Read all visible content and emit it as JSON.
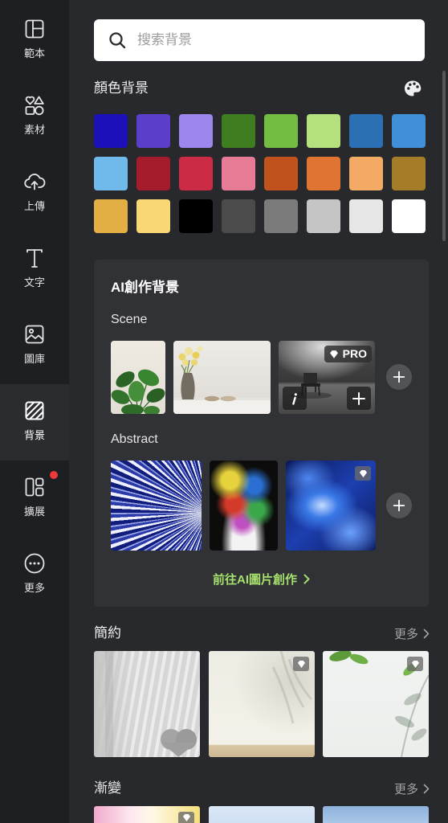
{
  "sidebar": {
    "items": [
      {
        "label": "範本",
        "icon": "template-icon"
      },
      {
        "label": "素材",
        "icon": "elements-icon"
      },
      {
        "label": "上傳",
        "icon": "upload-cloud-icon"
      },
      {
        "label": "文字",
        "icon": "text-icon"
      },
      {
        "label": "圖庫",
        "icon": "image-library-icon"
      },
      {
        "label": "背景",
        "icon": "background-icon",
        "active": true
      },
      {
        "label": "擴展",
        "icon": "extensions-icon",
        "notification_dot": true
      },
      {
        "label": "更多",
        "icon": "more-icon"
      }
    ]
  },
  "search": {
    "placeholder": "搜索背景",
    "value": "",
    "icon": "search-icon"
  },
  "color_backgrounds": {
    "title": "顏色背景",
    "icon": "palette-icon",
    "swatches": [
      "#1c10b8",
      "#5b3fcb",
      "#9d87ef",
      "#3f7e20",
      "#74bd43",
      "#b4e07e",
      "#2b6fb4",
      "#3f90d6",
      "#6fbaea",
      "#a41b2b",
      "#cc2b46",
      "#e87b96",
      "#c0531c",
      "#e07432",
      "#f3aa65",
      "#a57c27",
      "#e3ae44",
      "#f9d774",
      "#000000",
      "#4b4b4b",
      "#7b7b7b",
      "#c5c5c5",
      "#e6e6e6",
      "#ffffff"
    ]
  },
  "ai_backgrounds": {
    "title": "AI創作背景",
    "scene": {
      "label": "Scene",
      "pro_badge": "PRO"
    },
    "abstract": {
      "label": "Abstract"
    },
    "cta": "前往AI圖片創作"
  },
  "categories": [
    {
      "title": "簡約",
      "more": "更多"
    },
    {
      "title": "漸變",
      "more": "更多"
    }
  ],
  "colors": {
    "sidebar_bg": "#1e1f22",
    "panel_bg": "#28292c",
    "active_item_bg": "#2b2c30",
    "card_bg": "#313236",
    "accent_green": "#a6e06d",
    "notification_red": "#ec3a3a"
  }
}
